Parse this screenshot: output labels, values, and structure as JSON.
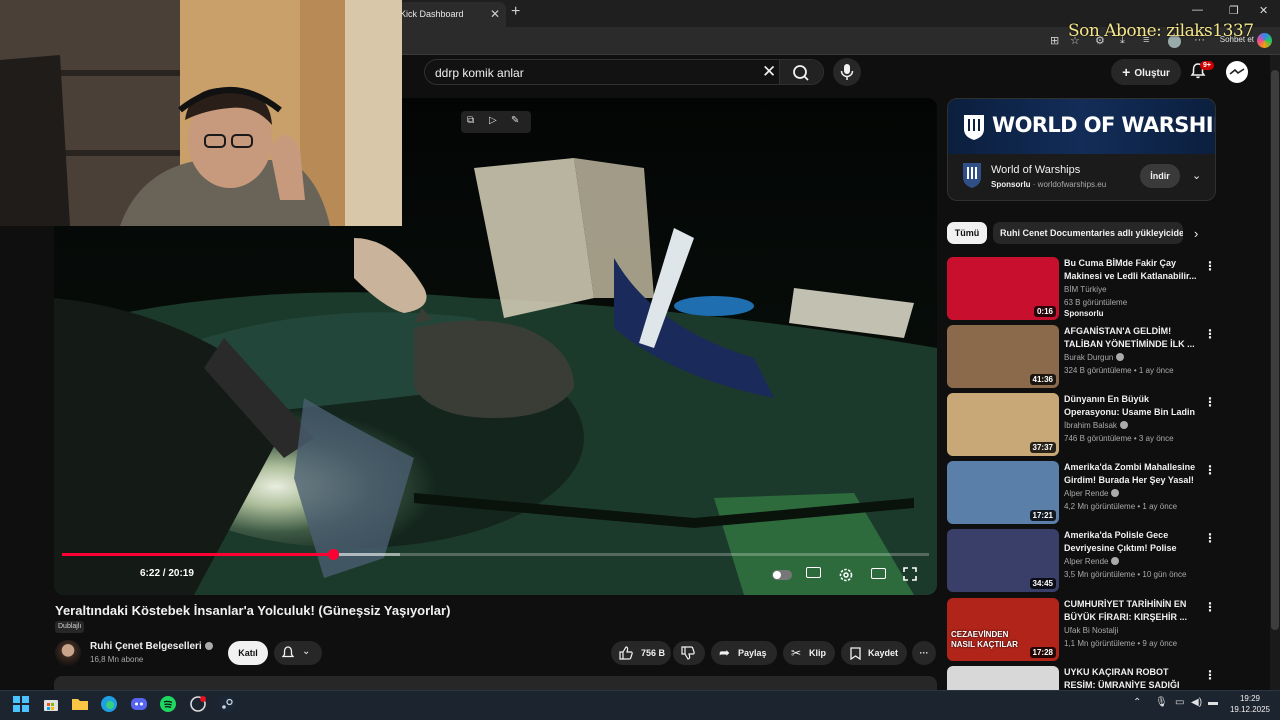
{
  "browser": {
    "tab_title": "Kick Dashboard",
    "sohbet_label": "Sohbet et"
  },
  "stream_overlay": {
    "last_subscriber": "Son Abone: zilaks1337"
  },
  "youtube": {
    "search": {
      "query": "ddrp komik anlar"
    },
    "create_label": "Oluştur",
    "notif_badge": "9+"
  },
  "video": {
    "current_time": "6:22",
    "duration": "20:19",
    "time_display": "6:22 / 20:19",
    "progress_fraction": 0.313,
    "buffered_fraction": 0.39,
    "title": "Yeraltındaki Köstebek İnsanlar'a Yolculuk! (Güneşsiz Yaşıyorlar)",
    "dubbed_label": "Dublajlı"
  },
  "channel": {
    "name": "Ruhi Çenet Belgeselleri",
    "subscribers": "16,8 Mn abone",
    "join_label": "Katıl"
  },
  "actions": {
    "likes": "756 B",
    "share": "Paylaş",
    "clip": "Klip",
    "save": "Kaydet"
  },
  "ad": {
    "banner_text": "WORLD OF WARSHIPS",
    "advertiser": "World of Warships",
    "sponsored": "Sponsorlu",
    "domain": "worldofwarships.eu",
    "install_label": "İndir"
  },
  "chips": {
    "all": "Tümü",
    "uploader": "Ruhi Cenet Documentaries adlı yükleyiciden"
  },
  "recommendations": [
    {
      "title": "Bu Cuma BİMde Fakir Çay Makinesi ve Ledli Katlanabilir...",
      "channel": "BİM Türkiye",
      "meta": "63 B görüntüleme",
      "sponsored": "Sponsorlu",
      "duration": "0:16",
      "verified": false,
      "thumb_color": "#c8102e"
    },
    {
      "title": "AFGANİSTAN'A GELDİM! TALİBAN YÖNETİMİNDE İLK ...",
      "channel": "Burak Durgun",
      "meta": "324 B görüntüleme • 1 ay önce",
      "duration": "41:36",
      "verified": true,
      "thumb_color": "#8a6a4a"
    },
    {
      "title": "Dünyanın En Büyük Operasyonu: Usame Bin Ladin Gerçekten ...",
      "channel": "İbrahim Balsak",
      "meta": "746 B görüntüleme • 3 ay önce",
      "duration": "37:37",
      "verified": true,
      "thumb_color": "#c9a878"
    },
    {
      "title": "Amerika'da Zombi Mahallesine Girdim! Burada Her Şey Yasal! ...",
      "channel": "Alper Rende",
      "meta": "4,2 Mn görüntüleme • 1 ay önce",
      "duration": "17:21",
      "verified": true,
      "thumb_color": "#5a7fa8"
    },
    {
      "title": "Amerika'da Polisle Gece Devriyesine Çıktım! Polise Küf...",
      "channel": "Alper Rende",
      "meta": "3,5 Mn görüntüleme • 10 gün önce",
      "duration": "34:45",
      "verified": true,
      "thumb_color": "#3a3f6a"
    },
    {
      "title": "CUMHURİYET TARİHİNİN EN BÜYÜK FİRARI: KIRŞEHİR ...",
      "channel": "Ufak Bi Nostalji",
      "meta": "1,1 Mn görüntüleme • 9 ay önce",
      "duration": "17:28",
      "verified": false,
      "thumb_color": "#b0241a",
      "thumb_caption": "CEZAEVİNDEN NASIL KAÇTILAR"
    },
    {
      "title": "UYKU KAÇIRAN ROBOT RESİM: ÜMRANİYE SADIĞI",
      "channel": "",
      "meta": "",
      "duration": "",
      "verified": false,
      "thumb_color": "#d8d8d8"
    }
  ],
  "taskbar": {
    "time": "19:29",
    "date": "19.12.2025"
  }
}
